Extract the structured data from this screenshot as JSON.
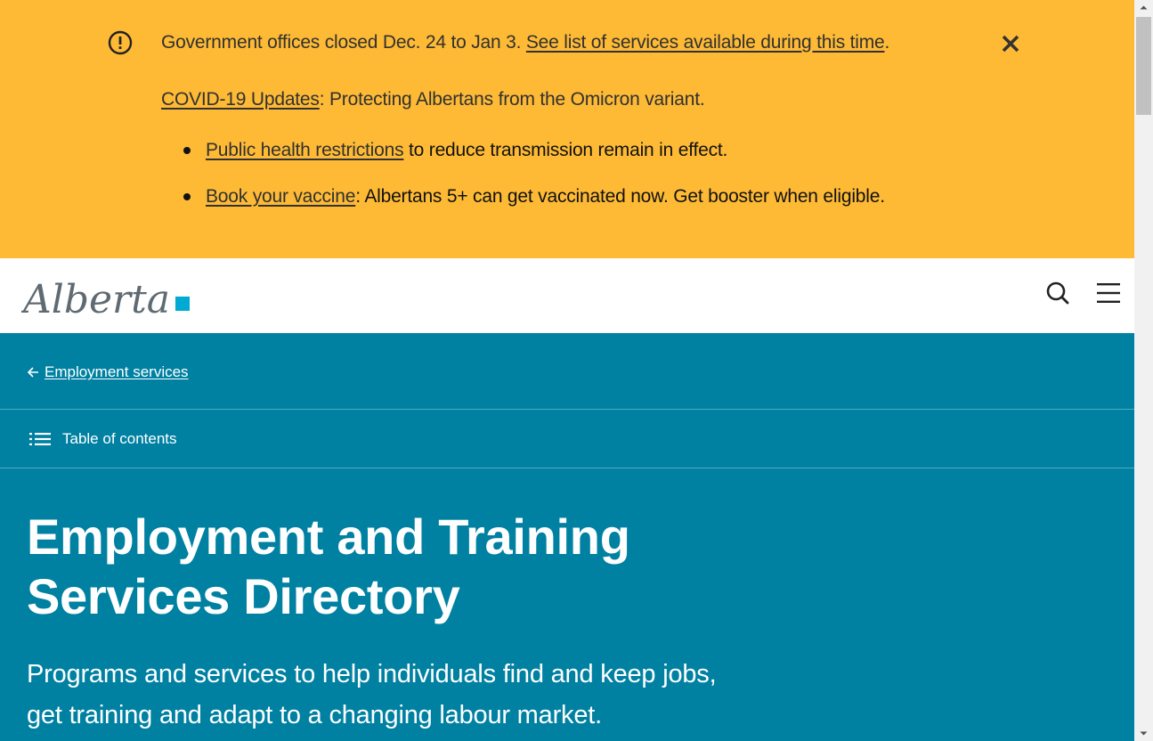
{
  "notice": {
    "line1_text": "Government offices closed Dec. 24 to Jan 3. ",
    "line1_link": "See list of services available during this time",
    "line1_end": ".",
    "line2_link": "COVID-19 Updates",
    "line2_text": ": Protecting Albertans from the Omicron variant.",
    "bullets": [
      {
        "link": "Public health restrictions",
        "text": " to reduce transmission remain in effect."
      },
      {
        "link": "Book your vaccine",
        "text": ": Albertans 5+ can get vaccinated now. Get booster when eligible."
      }
    ],
    "close_icon": "close-icon",
    "alert_icon": "exclamation-circle-icon"
  },
  "header": {
    "logo_text": "Alberta",
    "search_icon": "search-icon",
    "menu_icon": "hamburger-menu-icon"
  },
  "hero": {
    "back_link": "Employment services",
    "toc_label": "Table of contents",
    "title": "Employment and Training Services Directory",
    "lead": "Programs and services to help individuals find and keep jobs, get training and adapt to a changing labour market."
  },
  "colors": {
    "notice_bg": "#feba35",
    "hero_bg": "#0081a2",
    "logo_accent": "#00aad2",
    "logo_text": "#5f6a72"
  }
}
